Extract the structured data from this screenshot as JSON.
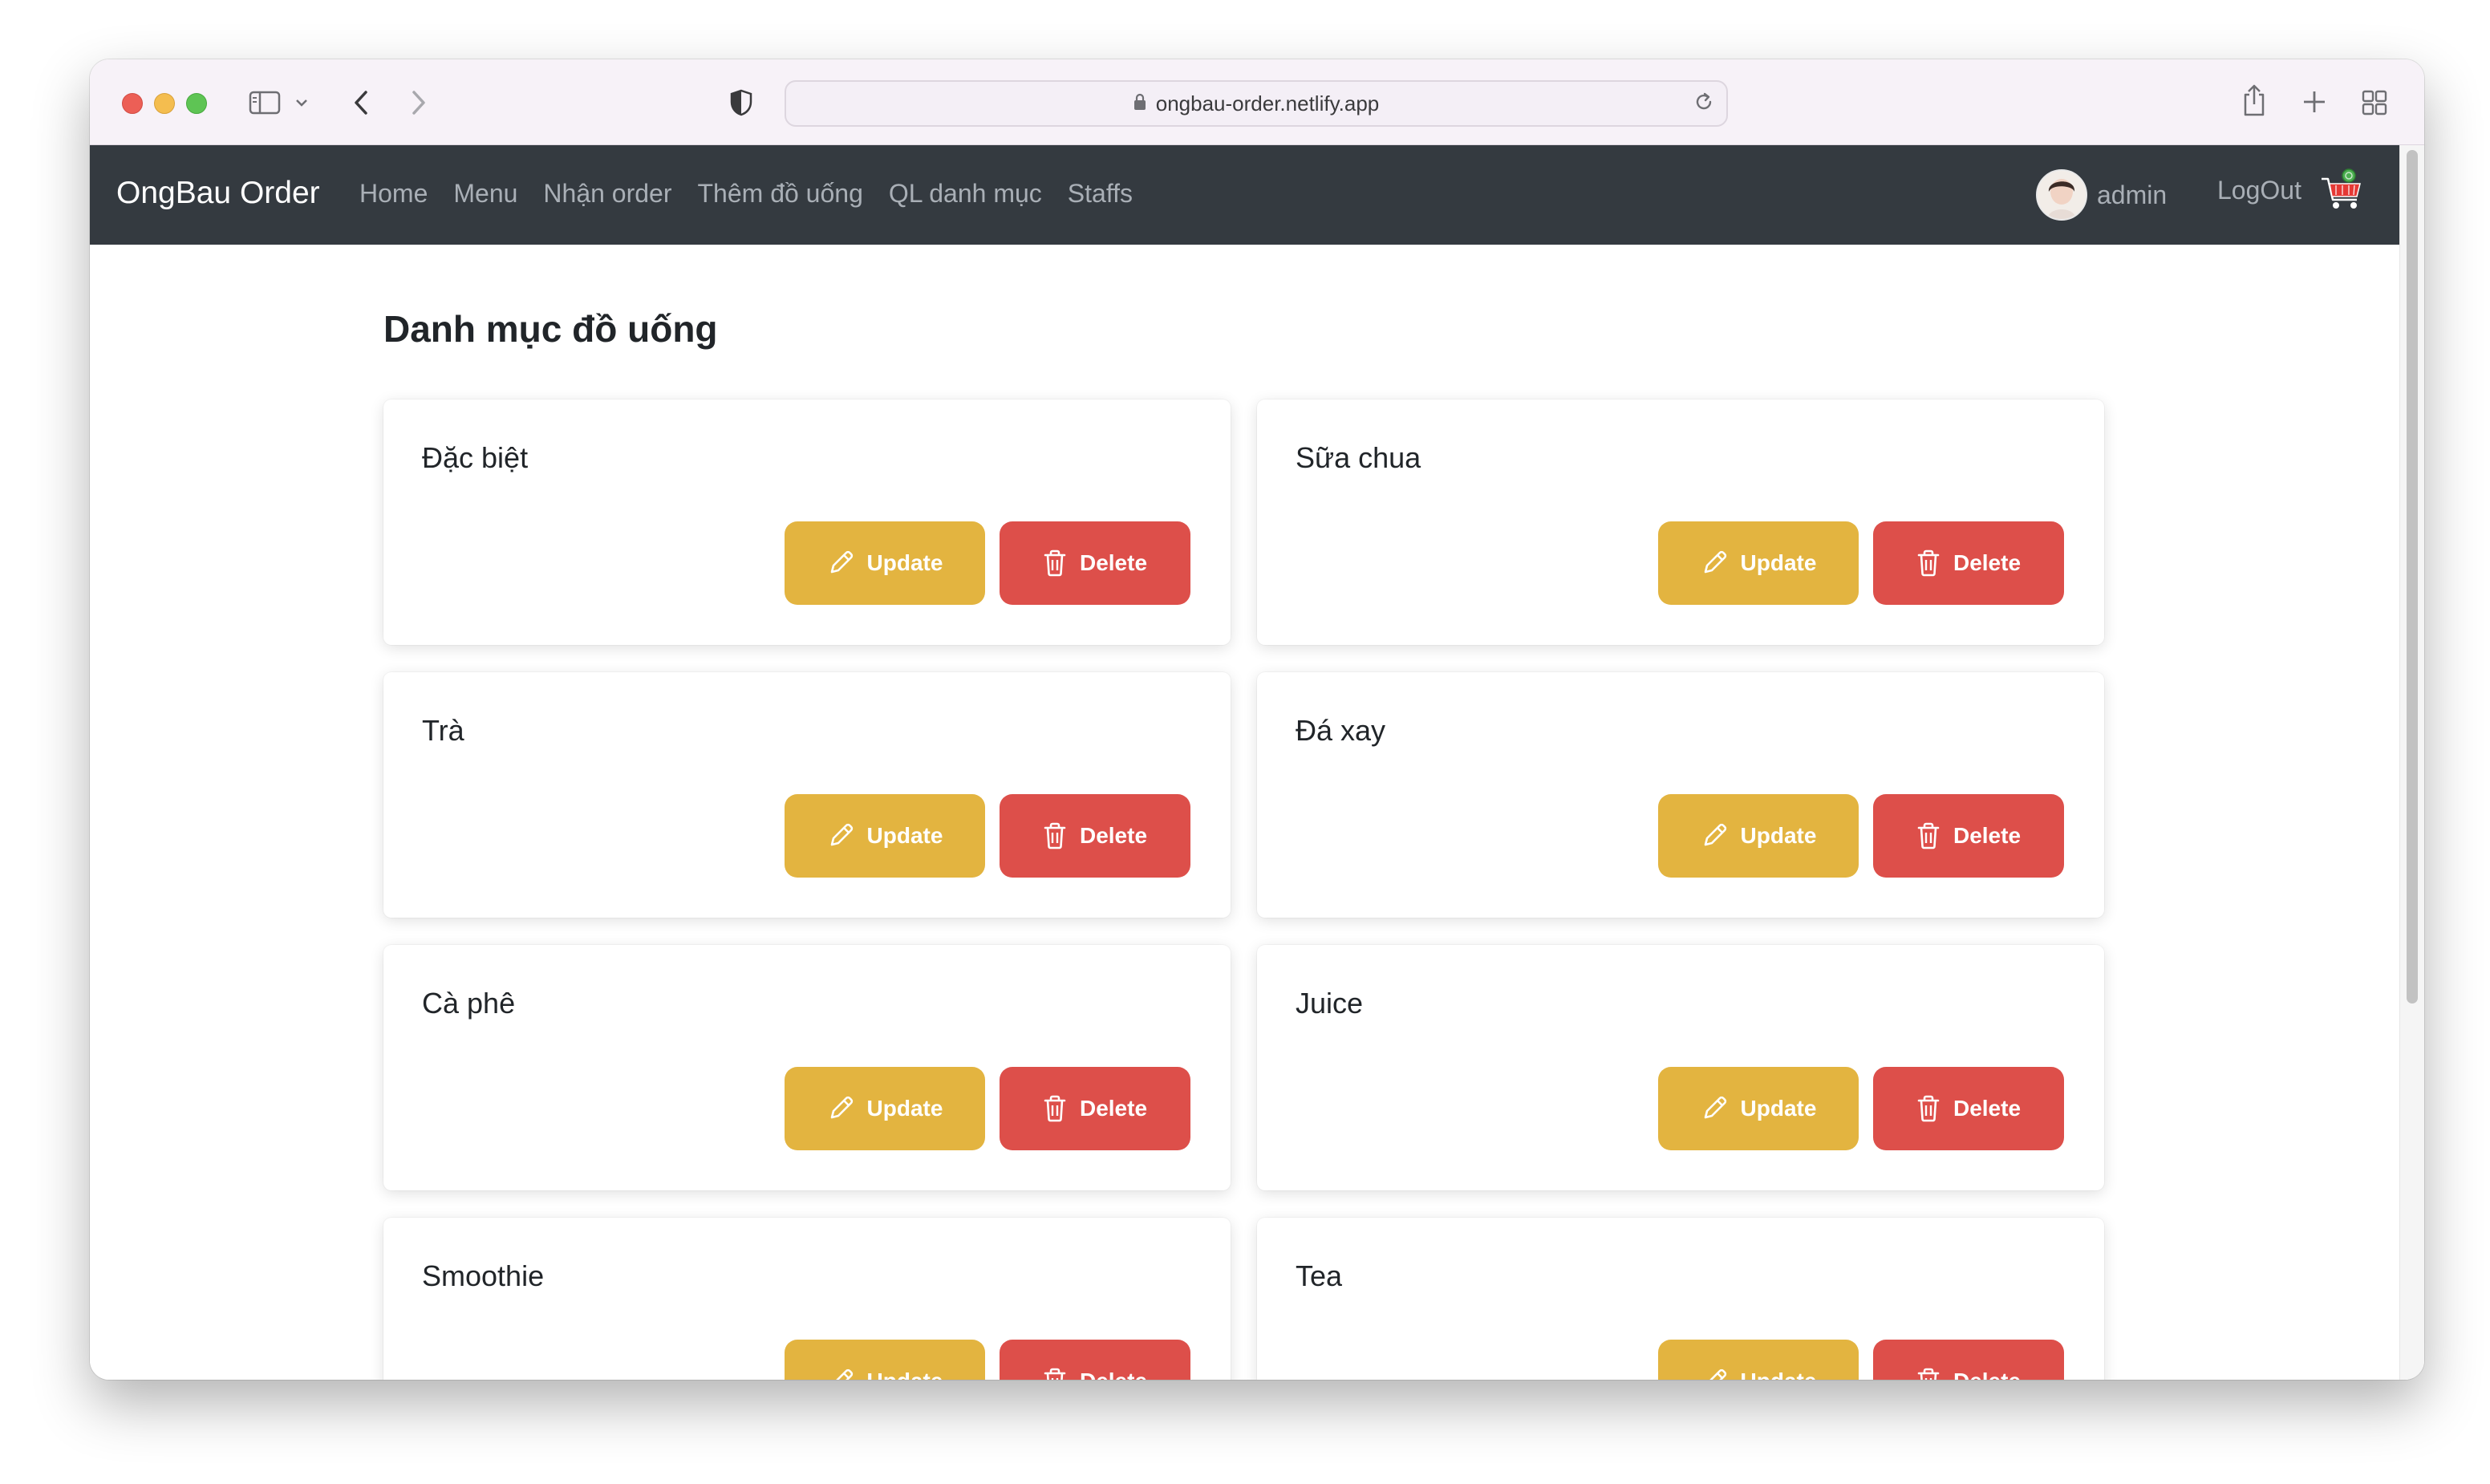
{
  "browser": {
    "url": "ongbau-order.netlify.app"
  },
  "navbar": {
    "brand": "OngBau Order",
    "links": [
      {
        "label": "Home"
      },
      {
        "label": "Menu"
      },
      {
        "label": "Nhận order"
      },
      {
        "label": "Thêm đồ uống"
      },
      {
        "label": "QL danh mục"
      },
      {
        "label": "Staffs"
      }
    ],
    "user_name": "admin",
    "logout_label": "LogOut"
  },
  "page": {
    "title": "Danh mục đồ uống"
  },
  "categories": [
    {
      "name": "Đặc biệt"
    },
    {
      "name": "Sữa chua"
    },
    {
      "name": "Trà"
    },
    {
      "name": "Đá xay"
    },
    {
      "name": "Cà phê"
    },
    {
      "name": "Juice"
    },
    {
      "name": "Smoothie"
    },
    {
      "name": "Tea"
    }
  ],
  "actions": {
    "update_label": "Update",
    "delete_label": "Delete"
  },
  "colors": {
    "navbar_bg": "#343a40",
    "update_btn": "#e3b440",
    "delete_btn": "#dd4f4a"
  },
  "icons": [
    "sidebar-icon",
    "chevron-down-icon",
    "back-icon",
    "forward-icon",
    "shield-icon",
    "lock-icon",
    "reload-icon",
    "share-icon",
    "plus-icon",
    "tabs-grid-icon",
    "cart-icon",
    "pencil-icon",
    "trash-icon"
  ]
}
